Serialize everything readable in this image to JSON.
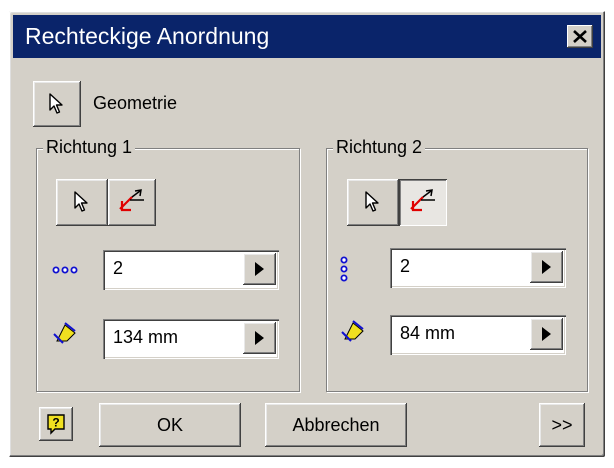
{
  "window": {
    "title": "Rechteckige Anordnung"
  },
  "geometry": {
    "label": "Geometrie"
  },
  "direction1": {
    "title": "Richtung 1",
    "count": "2",
    "distance": "134 mm"
  },
  "direction2": {
    "title": "Richtung 2",
    "count": "2",
    "distance": "84 mm"
  },
  "buttons": {
    "ok": "OK",
    "cancel": "Abbrechen",
    "more": ">>"
  },
  "icons": {
    "close": "close-icon",
    "select": "cursor-arrow-icon",
    "flip": "flip-direction-icon",
    "count_horizontal": "dots-horizontal-icon",
    "count_vertical": "dots-vertical-icon",
    "spacing": "spacing-icon",
    "help": "help-icon"
  },
  "colors": {
    "titlebar": "#0a246a",
    "face": "#d4d0c8",
    "accent_red": "#e00000",
    "icon_blue": "#1010d0",
    "icon_yellow": "#f0e020"
  }
}
